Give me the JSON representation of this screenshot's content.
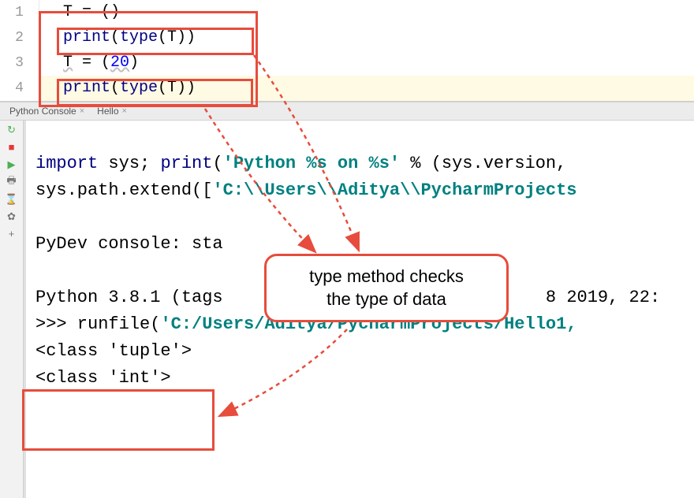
{
  "editor": {
    "lines": [
      {
        "num": "1",
        "indent": "",
        "tokens": [
          {
            "t": "plain",
            "v": "T = ()"
          }
        ]
      },
      {
        "num": "2",
        "indent": "",
        "tokens": [
          {
            "t": "kw",
            "v": "print"
          },
          {
            "t": "plain",
            "v": "("
          },
          {
            "t": "kw",
            "v": "type"
          },
          {
            "t": "plain",
            "v": "(T))"
          }
        ]
      },
      {
        "num": "3",
        "indent": "",
        "tokens": [
          {
            "t": "plain",
            "v": "T = ("
          },
          {
            "t": "num",
            "v": "20"
          },
          {
            "t": "plain",
            "v": ")"
          }
        ]
      },
      {
        "num": "4",
        "indent": "",
        "tokens": [
          {
            "t": "kw",
            "v": "print"
          },
          {
            "t": "plain",
            "v": "("
          },
          {
            "t": "kw",
            "v": "type"
          },
          {
            "t": "plain",
            "v": "(T))"
          }
        ]
      }
    ]
  },
  "tabs": {
    "tab1": "Python Console",
    "tab2": "Hello"
  },
  "console": {
    "line1_a": "import",
    "line1_b": " sys; ",
    "line1_c": "print",
    "line1_d": "(",
    "line1_e": "'Python %s on %s'",
    "line1_f": " % (sys.version, ",
    "line2_a": "sys.path.extend([",
    "line2_b": "'C:\\\\Users\\\\Aditya\\\\PycharmProjects",
    "line3": "",
    "line4": "PyDev console: sta",
    "line5": "",
    "line6_a": "Python 3.8.1 (tags",
    "line6_b": "8 2019, 22:",
    "line7_a": ">>> runfile(",
    "line7_b": "'C:/Users/Aditya/PycharmProjects/Hello1,",
    "line8": "<class 'tuple'>",
    "line9": "<class 'int'>"
  },
  "callout": {
    "line1": "type method checks",
    "line2": "the type of data"
  },
  "icons": {
    "rerun": "↻",
    "stop": "■",
    "play": "▶",
    "print": "🖶",
    "history": "⌛",
    "settings": "✿",
    "add": "+"
  }
}
